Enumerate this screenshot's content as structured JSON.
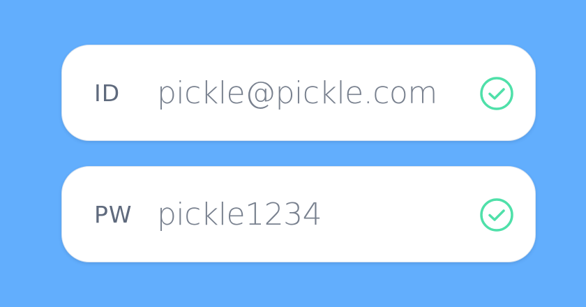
{
  "fields": [
    {
      "label": "ID",
      "value": "pickle@pickle.com",
      "status_icon": "check-circle-icon",
      "status": "valid"
    },
    {
      "label": "PW",
      "value": "pickle1234",
      "status_icon": "check-circle-icon",
      "status": "valid"
    }
  ],
  "colors": {
    "background": "#62aefd",
    "field_bg": "#ffffff",
    "label": "#5f6a7d",
    "value": "#78808e",
    "valid_check": "#4fe0a9"
  }
}
